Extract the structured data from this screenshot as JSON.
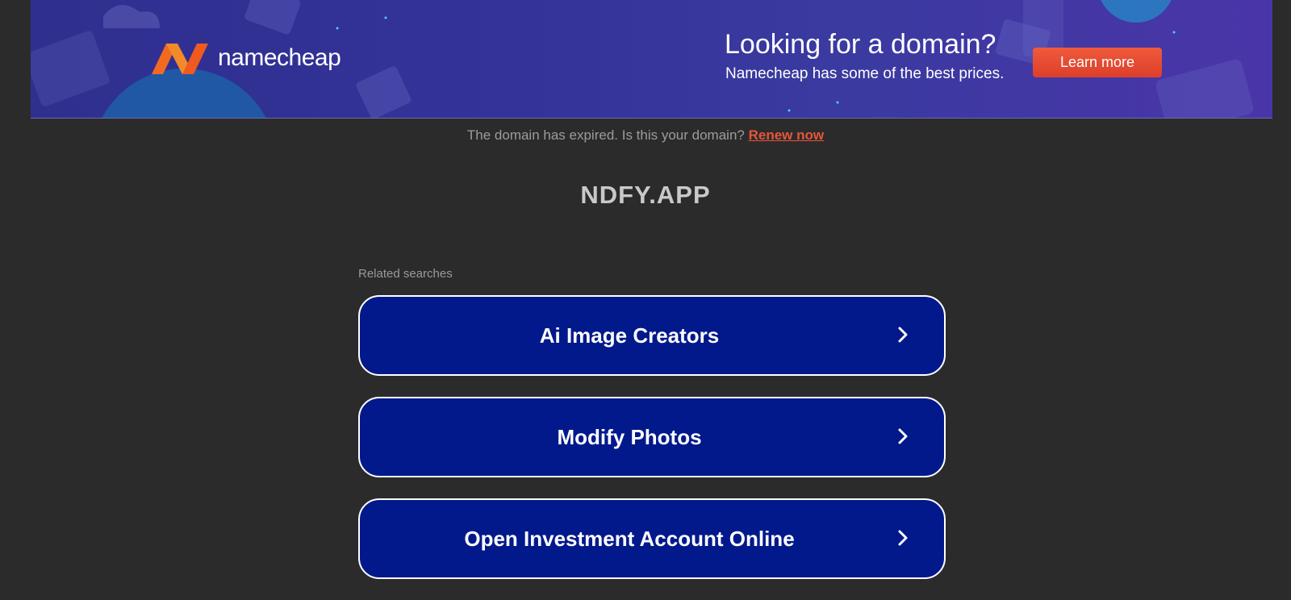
{
  "banner": {
    "logo_text": "namecheap",
    "headline": "Looking for a domain?",
    "subheadline": "Namecheap has some of the best prices.",
    "cta_label": "Learn more",
    "colors": {
      "logo_orange": "#f2672a",
      "cta_red": "#e54a33"
    }
  },
  "notice": {
    "text": "The domain has expired. Is this your domain?",
    "link_label": "Renew now"
  },
  "domain": {
    "name": "NDFY.APP"
  },
  "related": {
    "label": "Related searches",
    "items": [
      {
        "label": "Ai Image Creators",
        "icon": "chevron-right-icon"
      },
      {
        "label": "Modify Photos",
        "icon": "chevron-right-icon"
      },
      {
        "label": "Open Investment Account Online",
        "icon": "chevron-right-icon"
      }
    ]
  }
}
